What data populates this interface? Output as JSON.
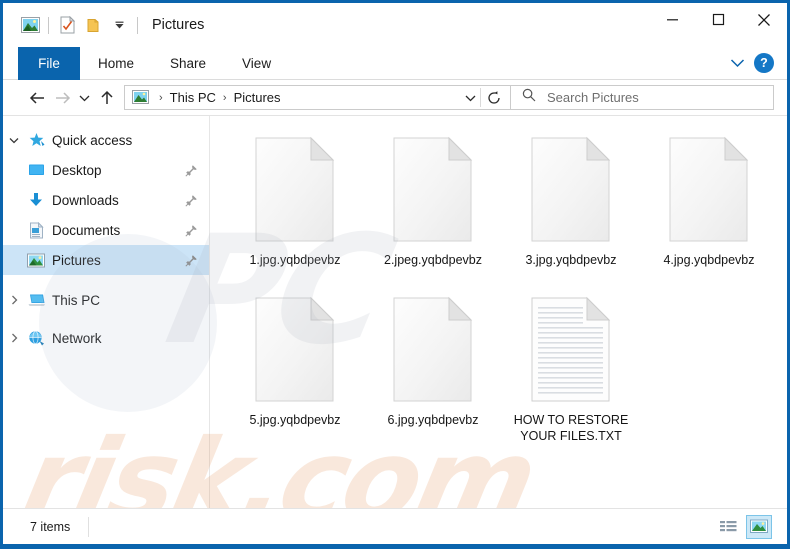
{
  "window": {
    "title": "Pictures",
    "accent_color": "#0a64ad",
    "selection_color": "#cce4f7",
    "quick_access_toolbar": [
      {
        "name": "pictures-icon",
        "label": "Pictures"
      },
      {
        "name": "properties-icon",
        "label": "Properties"
      },
      {
        "name": "new-folder-icon",
        "label": "New folder"
      },
      {
        "name": "customize-qat-icon",
        "label": "Customize Quick Access Toolbar"
      }
    ],
    "controls": [
      {
        "name": "minimize-button",
        "label": "Minimize"
      },
      {
        "name": "maximize-button",
        "label": "Maximize"
      },
      {
        "name": "close-button",
        "label": "Close"
      }
    ]
  },
  "ribbon": {
    "tabs": [
      {
        "label": "File",
        "active": true
      },
      {
        "label": "Home",
        "active": false
      },
      {
        "label": "Share",
        "active": false
      },
      {
        "label": "View",
        "active": false
      }
    ],
    "expand_label": "Expand the Ribbon",
    "help_label": "?"
  },
  "addressbar": {
    "back_label": "Back",
    "forward_label": "Forward",
    "recent_label": "Recent locations",
    "up_label": "Up",
    "breadcrumb": [
      "This PC",
      "Pictures"
    ],
    "separator": "›",
    "dropdown_label": "Previous locations",
    "refresh_label": "Refresh",
    "search": {
      "placeholder": "Search Pictures",
      "value": ""
    }
  },
  "sidebar": {
    "items": [
      {
        "label": "Quick access",
        "icon": "star-icon",
        "expander": "expanded",
        "indent": false,
        "pinned": false,
        "selected": false
      },
      {
        "label": "Desktop",
        "icon": "desktop-icon",
        "expander": "none",
        "indent": true,
        "pinned": true,
        "selected": false
      },
      {
        "label": "Downloads",
        "icon": "downloads-icon",
        "expander": "none",
        "indent": true,
        "pinned": true,
        "selected": false
      },
      {
        "label": "Documents",
        "icon": "documents-icon",
        "expander": "none",
        "indent": true,
        "pinned": true,
        "selected": false
      },
      {
        "label": "Pictures",
        "icon": "pictures-icon",
        "expander": "none",
        "indent": true,
        "pinned": true,
        "selected": true
      },
      {
        "label": "This PC",
        "icon": "this-pc-icon",
        "expander": "collapsed",
        "indent": false,
        "pinned": false,
        "selected": false
      },
      {
        "label": "Network",
        "icon": "network-icon",
        "expander": "collapsed",
        "indent": false,
        "pinned": false,
        "selected": false
      }
    ]
  },
  "files": [
    {
      "name": "1.jpg.yqbdpevbz",
      "icon": "blank-file-icon"
    },
    {
      "name": "2.jpeg.yqbdpevbz",
      "icon": "blank-file-icon"
    },
    {
      "name": "3.jpg.yqbdpevbz",
      "icon": "blank-file-icon"
    },
    {
      "name": "4.jpg.yqbdpevbz",
      "icon": "blank-file-icon"
    },
    {
      "name": "5.jpg.yqbdpevbz",
      "icon": "blank-file-icon"
    },
    {
      "name": "6.jpg.yqbdpevbz",
      "icon": "blank-file-icon"
    },
    {
      "name": "HOW TO RESTORE YOUR FILES.TXT",
      "icon": "text-file-icon"
    }
  ],
  "statusbar": {
    "item_count": "7 items",
    "views": [
      {
        "name": "details-view-button",
        "label": "Details view",
        "active": false
      },
      {
        "name": "large-icons-view-button",
        "label": "Large icons view",
        "active": true
      }
    ]
  },
  "watermark": {
    "line1": "PC",
    "line2": "risk.com"
  }
}
